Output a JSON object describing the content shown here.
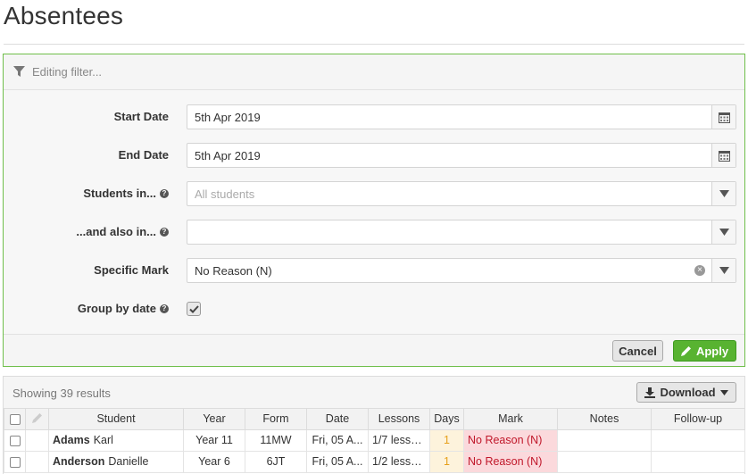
{
  "page": {
    "title": "Absentees"
  },
  "filter": {
    "header_text": "Editing filter...",
    "fields": {
      "start_date": {
        "label": "Start Date",
        "value": "5th Apr 2019"
      },
      "end_date": {
        "label": "End Date",
        "value": "5th Apr 2019"
      },
      "students_in": {
        "label": "Students in...",
        "placeholder": "All students"
      },
      "also_in": {
        "label": "...and also in...",
        "value": ""
      },
      "specific_mark": {
        "label": "Specific Mark",
        "value": "No Reason (N)"
      },
      "group_by_date": {
        "label": "Group by date",
        "checked": true
      }
    },
    "cancel_label": "Cancel",
    "apply_label": "Apply"
  },
  "results": {
    "count_text": "Showing 39 results",
    "download_label": "Download",
    "columns": [
      "Student",
      "Year",
      "Form",
      "Date",
      "Lessons",
      "Days",
      "Mark",
      "Notes",
      "Follow-up"
    ],
    "rows": [
      {
        "surname": "Adams",
        "forename": "Karl",
        "year": "Year 11",
        "form": "11MW",
        "date": "Fri, 05 A...",
        "lessons": "1/7 lesso...",
        "days": "1",
        "mark": "No Reason (N)",
        "notes": "",
        "followup": ""
      },
      {
        "surname": "Anderson",
        "forename": "Danielle",
        "year": "Year 6",
        "form": "6JT",
        "date": "Fri, 05 A...",
        "lessons": "1/2 lesso...",
        "days": "1",
        "mark": "No Reason (N)",
        "notes": "",
        "followup": ""
      }
    ]
  },
  "colors": {
    "accent_green": "#58b331",
    "panel_border_green": "#6fbf4a",
    "mark_bg": "#fbd9dc",
    "mark_text": "#c0172a",
    "days_text": "#e6a01a"
  },
  "icons": {
    "filter": "filter-icon",
    "calendar": "calendar-icon",
    "dropdown": "caret-down-icon",
    "help": "question-circle-icon",
    "clear": "clear-x-icon",
    "check": "check-icon",
    "apply": "pencil-icon",
    "download": "download-icon",
    "edit": "pencil-icon"
  }
}
